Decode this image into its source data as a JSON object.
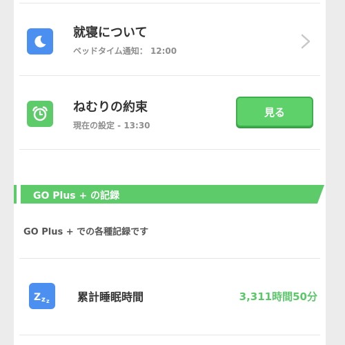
{
  "bedtime": {
    "title": "就寝について",
    "subtitle": "ベッドタイム通知： 12:00",
    "icon": "moon-icon"
  },
  "promise": {
    "title": "ねむりの約束",
    "subtitle": "現在の設定 - 13:30",
    "icon": "alarm-clock-icon",
    "button_label": "見る"
  },
  "section": {
    "title": "GO Plus + の記録",
    "description": "GO Plus + での各種記録です"
  },
  "sleep_total": {
    "icon": "zzz-icon",
    "label": "累計睡眠時間",
    "value": "3,311時間50分"
  },
  "colors": {
    "accent_green": "#5dcb6a",
    "icon_blue": "#4b8ff0"
  }
}
